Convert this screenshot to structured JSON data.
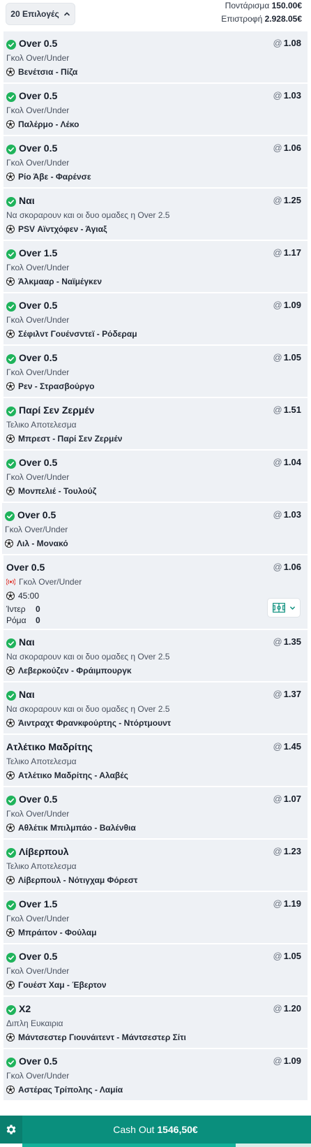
{
  "header": {
    "selections_label": "20 Επιλογές",
    "stake_label": "Ποντάρισμα",
    "stake_value": "150.00€",
    "return_label": "Επιστροφή",
    "return_value": "2.928.05€"
  },
  "selections": [
    {
      "selection": "Over 0.5",
      "market": "Γκολ Over/Under",
      "event": "Βενέτσια - Πίζα",
      "odds": "1.08",
      "settled": true
    },
    {
      "selection": "Over 0.5",
      "market": "Γκολ Over/Under",
      "event": "Παλέρμο - Λέκο",
      "odds": "1.03",
      "settled": true
    },
    {
      "selection": "Over 0.5",
      "market": "Γκολ Over/Under",
      "event": "Ρίο Άβε - Φαρένσε",
      "odds": "1.06",
      "settled": true
    },
    {
      "selection": "Ναι",
      "market": "Να σκοραρουν και οι δυο ομαδες η Over 2.5",
      "event": "PSV Αϊντχόφεν - Άγιαξ",
      "odds": "1.25",
      "settled": true
    },
    {
      "selection": "Over 1.5",
      "market": "Γκολ Over/Under",
      "event": "Άλκμααρ - Ναϊμέγκεν",
      "odds": "1.17",
      "settled": true
    },
    {
      "selection": "Over 0.5",
      "market": "Γκολ Over/Under",
      "event": "Σέφιλντ Γουένσντεϊ - Ρόδεραμ",
      "odds": "1.09",
      "settled": true
    },
    {
      "selection": "Over 0.5",
      "market": "Γκολ Over/Under",
      "event": "Ρεν - Στρασβούργο",
      "odds": "1.05",
      "settled": true
    },
    {
      "selection": "Παρί Σεν Ζερμέν",
      "market": "Τελικο Αποτελεσμα",
      "event": "Μπρεστ - Παρί Σεν Ζερμέν",
      "odds": "1.51",
      "settled": true
    },
    {
      "selection": "Over 0.5",
      "market": "Γκολ Over/Under",
      "event": "Μονπελιέ - Τουλούζ",
      "odds": "1.04",
      "settled": true
    },
    {
      "selection": "Over 0.5",
      "market": "Γκολ Over/Under",
      "event": "Λιλ - Μονακό",
      "odds": "1.03",
      "settled": true
    }
  ],
  "live_selection": {
    "selection": "Over 0.5",
    "market": "Γκολ Over/Under",
    "time": "45:00",
    "home_team": "Ίντερ",
    "home_score": "0",
    "away_team": "Ρόμα",
    "away_score": "0",
    "odds": "1.06"
  },
  "selections2": [
    {
      "selection": "Ναι",
      "market": "Να σκοραρουν και οι δυο ομαδες η Over 2.5",
      "event": "Λεβερκούζεν - Φράιμπουργκ",
      "odds": "1.35",
      "settled": true
    },
    {
      "selection": "Ναι",
      "market": "Να σκοραρουν και οι δυο ομαδες η Over 2.5",
      "event": "Άιντραχτ Φρανκφούρτης - Ντόρτμουντ",
      "odds": "1.37",
      "settled": true
    },
    {
      "selection": "Ατλέτικο Μαδρίτης",
      "market": "Τελικο Αποτελεσμα",
      "event": "Ατλέτικο Μαδρίτης - Αλαβές",
      "odds": "1.45",
      "settled": false
    },
    {
      "selection": "Over 0.5",
      "market": "Γκολ Over/Under",
      "event": "Αθλέτικ Μπιλμπάο - Βαλένθια",
      "odds": "1.07",
      "settled": true
    },
    {
      "selection": "Λίβερπουλ",
      "market": "Τελικο Αποτελεσμα",
      "event": "Λίβερπουλ - Νότιγχαμ Φόρεστ",
      "odds": "1.23",
      "settled": true
    },
    {
      "selection": "Over 1.5",
      "market": "Γκολ Over/Under",
      "event": "Μπράιτον - Φούλαμ",
      "odds": "1.19",
      "settled": true
    },
    {
      "selection": "Over 0.5",
      "market": "Γκολ Over/Under",
      "event": "Γουέστ Χαμ - Έβερτον",
      "odds": "1.05",
      "settled": true
    },
    {
      "selection": "X2",
      "market": "Διπλη Ευκαιρια",
      "event": "Μάντσεστερ Γιουνάιτεντ - Μάντσεστερ Σίτι",
      "odds": "1.20",
      "settled": true
    },
    {
      "selection": "Over 0.5",
      "market": "Γκολ Over/Under",
      "event": "Αστέρας Τρίπολης - Λαμία",
      "odds": "1.09",
      "settled": true
    }
  ],
  "odds_prefix": "@",
  "cashout": {
    "label": "Cash Out",
    "amount": "1546,50€",
    "progress": 0.74
  },
  "colors": {
    "accent": "#0a8f7d",
    "check": "#1fb35b",
    "card_bg": "#eef1f5"
  },
  "icons": {
    "check": "check-circle-icon",
    "ball": "soccer-ball-icon",
    "live": "live-broadcast-icon",
    "pitch": "pitch-icon",
    "gear": "gear-icon",
    "chevron": "chevron-up-icon"
  }
}
